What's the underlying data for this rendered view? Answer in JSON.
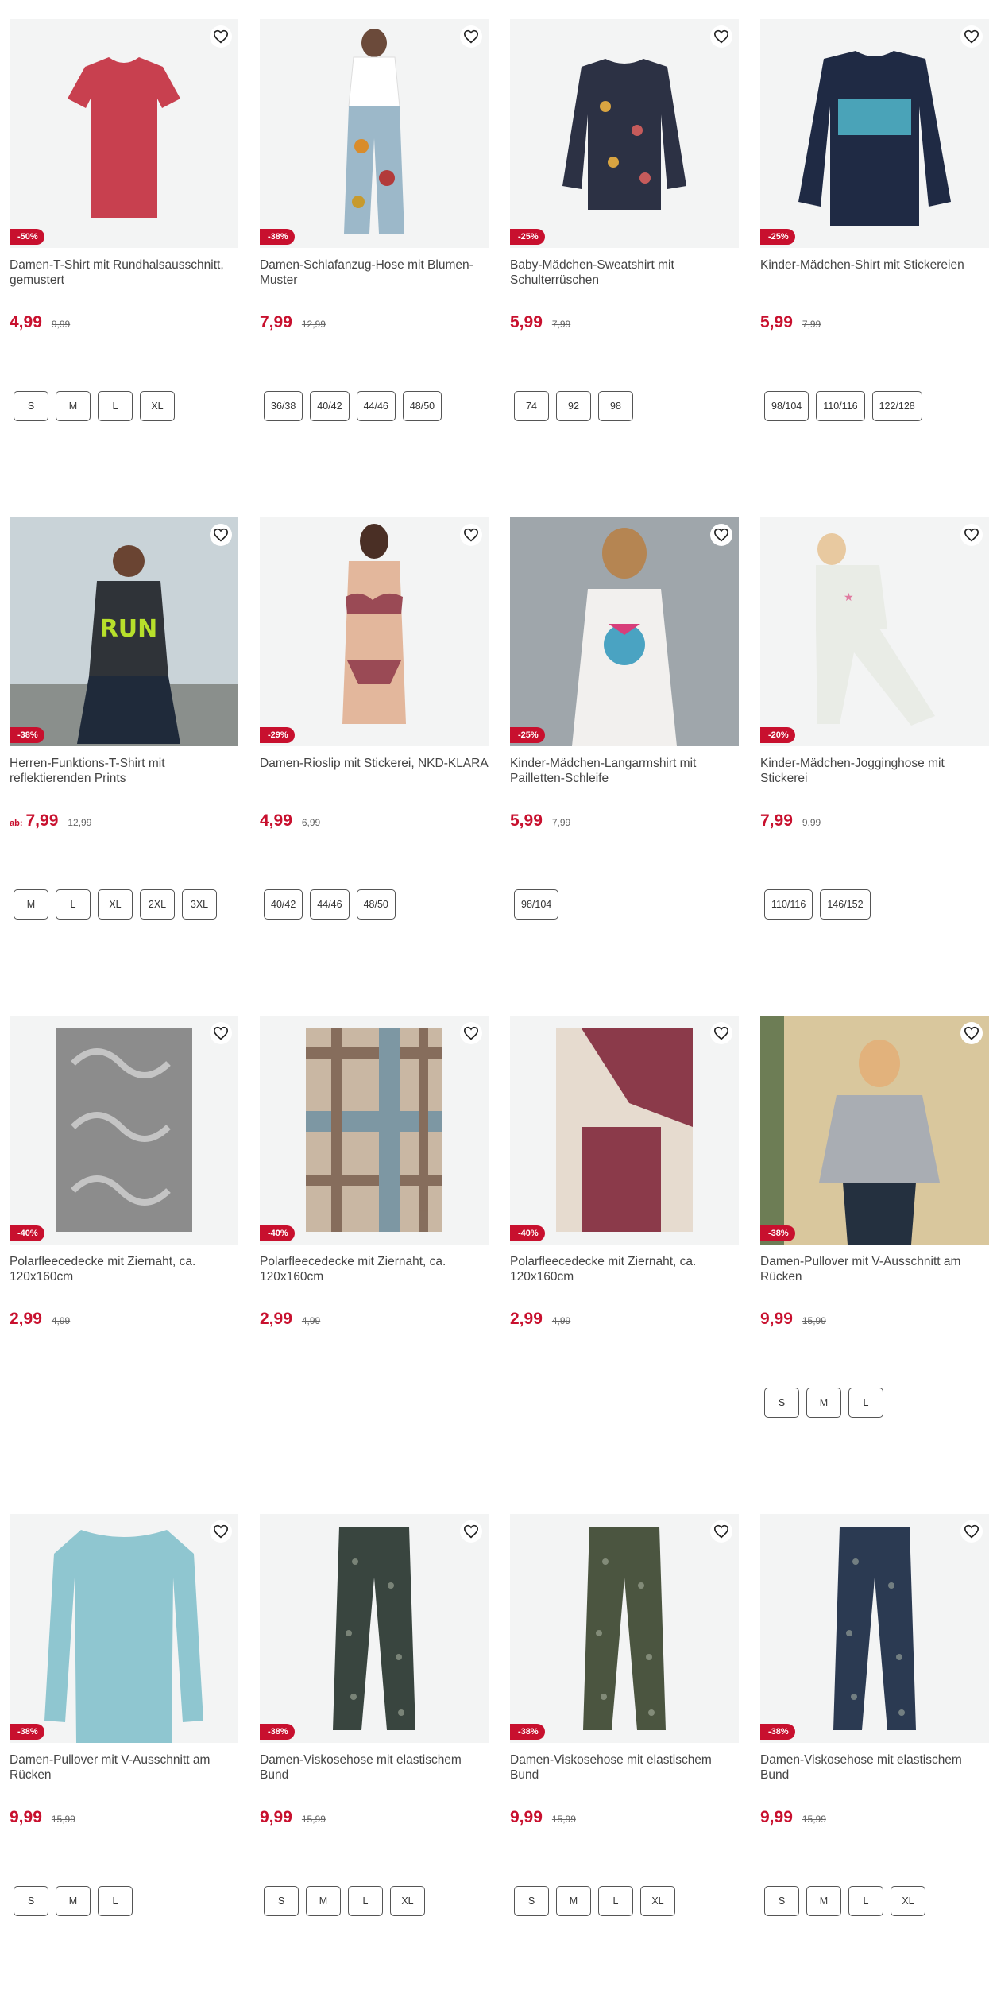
{
  "products": [
    {
      "name": "Damen-T-Shirt mit Rundhalsausschnitt, gemustert",
      "discount": "-50%",
      "prefix": "",
      "price": "4,99",
      "old_price": "9,99",
      "sizes": [
        "S",
        "M",
        "L",
        "XL"
      ],
      "icon": "t-shirt-image",
      "color": "#c8404f"
    },
    {
      "name": "Damen-Schlafanzug-Hose mit Blumen-Muster",
      "discount": "-38%",
      "prefix": "",
      "price": "7,99",
      "old_price": "12,99",
      "sizes": [
        "36/38",
        "40/42",
        "44/46",
        "48/50"
      ],
      "icon": "pajama-pants-image",
      "color": "#9cb8c9"
    },
    {
      "name": "Baby-Mädchen-Sweatshirt mit Schulterrüschen",
      "discount": "-25%",
      "prefix": "",
      "price": "5,99",
      "old_price": "7,99",
      "sizes": [
        "74",
        "92",
        "98"
      ],
      "icon": "sweatshirt-image",
      "color": "#2c3144"
    },
    {
      "name": "Kinder-Mädchen-Shirt mit Stickereien",
      "discount": "-25%",
      "prefix": "",
      "price": "5,99",
      "old_price": "7,99",
      "sizes": [
        "98/104",
        "110/116",
        "122/128"
      ],
      "icon": "kids-shirt-image",
      "color": "#1f2a44"
    },
    {
      "name": "Herren-Funktions-T-Shirt mit reflektierenden Prints",
      "discount": "-38%",
      "prefix": "ab:",
      "price": "7,99",
      "old_price": "12,99",
      "sizes": [
        "M",
        "L",
        "XL",
        "2XL",
        "3XL"
      ],
      "icon": "sport-shirt-image",
      "color": "#2f3338"
    },
    {
      "name": "Damen-Rioslip mit Stickerei, NKD-KLARA",
      "discount": "-29%",
      "prefix": "",
      "price": "4,99",
      "old_price": "6,99",
      "sizes": [
        "40/42",
        "44/46",
        "48/50"
      ],
      "icon": "lingerie-image",
      "color": "#9a4a55"
    },
    {
      "name": "Kinder-Mädchen-Langarmshirt mit Pailletten-Schleife",
      "discount": "-25%",
      "prefix": "",
      "price": "5,99",
      "old_price": "7,99",
      "sizes": [
        "98/104"
      ],
      "icon": "longsleeve-image",
      "color": "#f2f0ee"
    },
    {
      "name": "Kinder-Mädchen-Jogginghose mit Stickerei",
      "discount": "-20%",
      "prefix": "",
      "price": "7,99",
      "old_price": "9,99",
      "sizes": [
        "110/116",
        "146/152"
      ],
      "icon": "jogging-pants-image",
      "color": "#e9ece6"
    },
    {
      "name": "Polarfleecedecke mit Ziernaht, ca. 120x160cm",
      "discount": "-40%",
      "prefix": "",
      "price": "2,99",
      "old_price": "4,99",
      "sizes": [],
      "icon": "blanket-grey-image",
      "color": "#8c8c8c"
    },
    {
      "name": "Polarfleecedecke mit Ziernaht, ca. 120x160cm",
      "discount": "-40%",
      "prefix": "",
      "price": "2,99",
      "old_price": "4,99",
      "sizes": [],
      "icon": "blanket-plaid-image",
      "color": "#5e8aa3"
    },
    {
      "name": "Polarfleecedecke mit Ziernaht, ca. 120x160cm",
      "discount": "-40%",
      "prefix": "",
      "price": "2,99",
      "old_price": "4,99",
      "sizes": [],
      "icon": "blanket-red-image",
      "color": "#8b3a4a"
    },
    {
      "name": "Damen-Pullover mit V-Ausschnitt am Rücken",
      "discount": "-38%",
      "prefix": "",
      "price": "9,99",
      "old_price": "15,99",
      "sizes": [
        "S",
        "M",
        "L"
      ],
      "icon": "pullover-grey-image",
      "color": "#a9adb3"
    },
    {
      "name": "Damen-Pullover mit V-Ausschnitt am Rücken",
      "discount": "-38%",
      "prefix": "",
      "price": "9,99",
      "old_price": "15,99",
      "sizes": [
        "S",
        "M",
        "L"
      ],
      "icon": "pullover-blue-image",
      "color": "#8fc6d0"
    },
    {
      "name": "Damen-Viskosehose mit elastischem Bund",
      "discount": "-38%",
      "prefix": "",
      "price": "9,99",
      "old_price": "15,99",
      "sizes": [
        "S",
        "M",
        "L",
        "XL"
      ],
      "icon": "viscose-pants-image",
      "color": "#39453f"
    },
    {
      "name": "Damen-Viskosehose mit elastischem Bund",
      "discount": "-38%",
      "prefix": "",
      "price": "9,99",
      "old_price": "15,99",
      "sizes": [
        "S",
        "M",
        "L",
        "XL"
      ],
      "icon": "viscose-pants-image",
      "color": "#4b5540"
    },
    {
      "name": "Damen-Viskosehose mit elastischem Bund",
      "discount": "-38%",
      "prefix": "",
      "price": "9,99",
      "old_price": "15,99",
      "sizes": [
        "S",
        "M",
        "L",
        "XL"
      ],
      "icon": "viscose-pants-image",
      "color": "#2b3a52"
    }
  ],
  "colors": {
    "accent": "#c8102e",
    "image_bg": "#f3f4f4"
  }
}
